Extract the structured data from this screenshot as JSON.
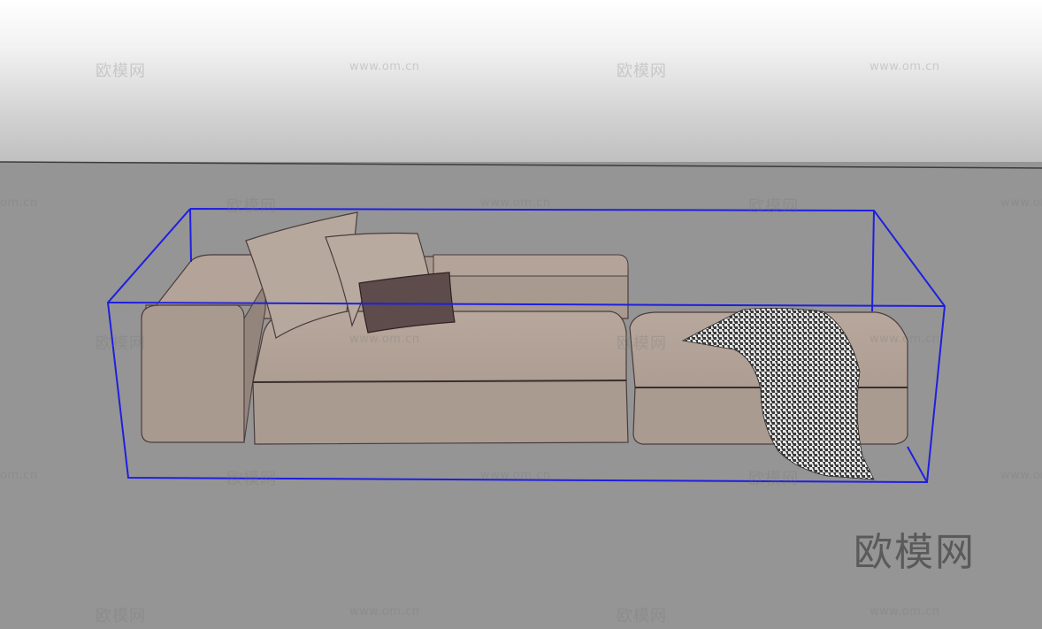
{
  "scene": {
    "sky_color_top": "#ffffff",
    "sky_color_bottom": "#bfbfbf",
    "ground_color": "#959595",
    "selection_color": "#1f1fe0",
    "fabric_color": "#b4a49a",
    "dark_cushion_color": "#5e4b4b"
  },
  "watermarks": {
    "brand_text": "欧模网",
    "url_text": "www.om.cn",
    "url_cropped_left": "om.cn",
    "url_cropped_right": "www.om"
  },
  "logo": {
    "text": "欧模网"
  }
}
